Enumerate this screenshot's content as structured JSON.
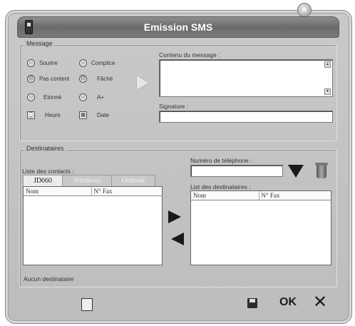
{
  "window": {
    "title": "Emission SMS"
  },
  "message": {
    "legend": "Message",
    "emoticons": [
      {
        "label": "Sourire",
        "icon": "smile-icon",
        "glyph": "☺"
      },
      {
        "label": "Complice",
        "icon": "wink-icon",
        "glyph": "☺"
      },
      {
        "label": "Pas content",
        "icon": "sad-icon",
        "glyph": "☹"
      },
      {
        "label": "Fâché",
        "icon": "angry-icon",
        "glyph": "☹"
      },
      {
        "label": "Etonné",
        "icon": "surprised-icon",
        "glyph": "☺"
      },
      {
        "label": "A+",
        "icon": "later-icon",
        "glyph": "☺"
      },
      {
        "label": "Heure",
        "icon": "clock-icon",
        "glyph": "⌚"
      },
      {
        "label": "Date",
        "icon": "calendar-icon",
        "glyph": "▦"
      }
    ],
    "content_label": "Contenu du message :",
    "content_value": "",
    "signature_label": "Signature :",
    "signature_value": ""
  },
  "recipients": {
    "legend": "Destinataires",
    "contacts_label": "Liste des contacts :",
    "tabs": [
      "JD660",
      "Windows",
      "Outlook"
    ],
    "contacts_columns": [
      "Nom",
      "N° Fax"
    ],
    "phone_label": "Numéro de téléphone :",
    "phone_value": "",
    "dest_list_label": "List des destinataires :",
    "dest_columns": [
      "Nom",
      "N° Fax"
    ],
    "status": "Aucun destinataire"
  },
  "footer": {
    "ok_label": "OK",
    "cancel_glyph": "✕"
  }
}
